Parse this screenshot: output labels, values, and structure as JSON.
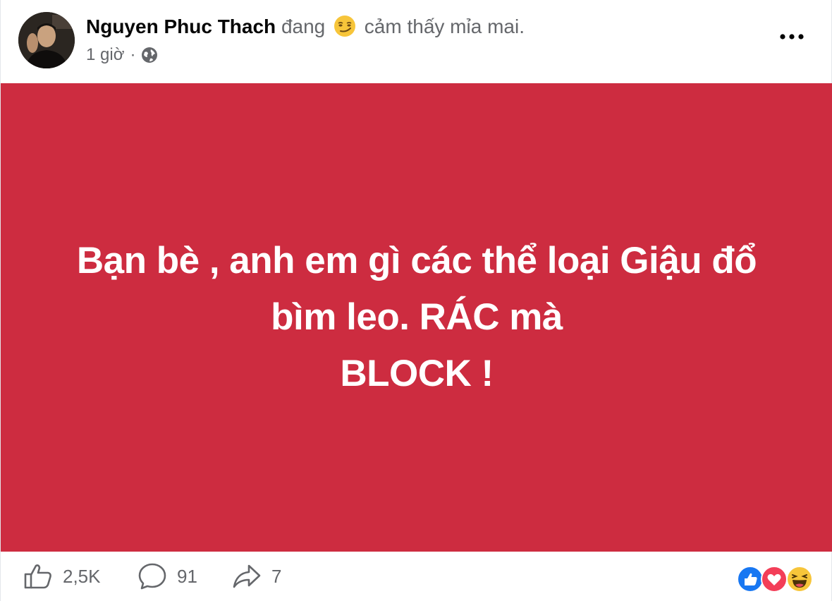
{
  "post": {
    "author": "Nguyen Phuc Thach",
    "feeling_prefix": "đang",
    "feeling_emoji": "smirk-emoji",
    "feeling_text": "cảm thấy mỉa mai.",
    "time": "1 giờ",
    "separator": "·",
    "privacy_icon": "globe-icon",
    "more_icon": "more-dots-icon"
  },
  "content": {
    "background_color": "#cd2c40",
    "lines": [
      "Bạn bè , anh em gì các thể loại Giậu đổ",
      "bìm leo. RÁC mà",
      "BLOCK !"
    ]
  },
  "footer": {
    "like_count": "2,5K",
    "comment_count": "91",
    "share_count": "7",
    "reaction_icons": [
      "like-reaction-icon",
      "love-reaction-icon",
      "haha-reaction-icon"
    ]
  }
}
